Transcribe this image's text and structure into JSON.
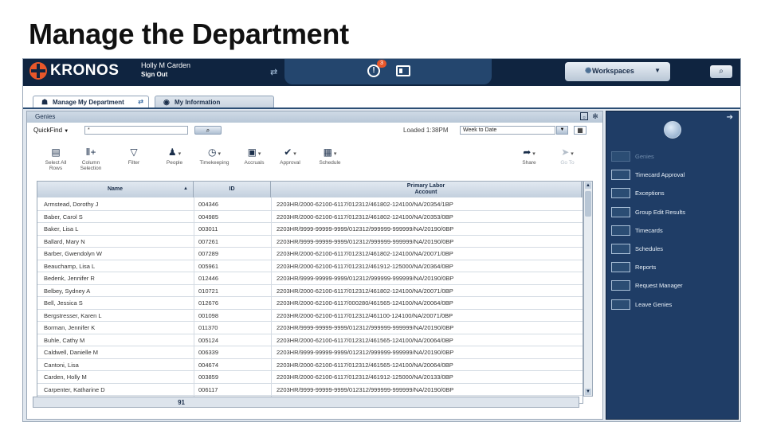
{
  "slide": {
    "title": "Manage the Department"
  },
  "topbar": {
    "logo_text": "KRONOS",
    "user_name": "Holly M Carden",
    "sign_out": "Sign Out",
    "alert_count": "3",
    "workspaces_label": "Workspaces"
  },
  "tabs": [
    {
      "label": "Manage My Department"
    },
    {
      "label": "My Information"
    }
  ],
  "genies": {
    "title": "Genies",
    "quickfind_label": "QuickFind",
    "quickfind_value": "*",
    "loaded": "Loaded 1:38PM",
    "period": "Week to Date",
    "toolbar": [
      {
        "icon": "select-all-icon",
        "label": "Select All\nRows",
        "glyph": "▤"
      },
      {
        "icon": "column-selection-icon",
        "label": "Column\nSelection",
        "glyph": "Ⅱ+"
      },
      {
        "icon": "filter-icon",
        "label": "Filter",
        "glyph": "▽"
      },
      {
        "icon": "people-icon",
        "label": "People",
        "glyph": "♟"
      },
      {
        "icon": "timekeeping-icon",
        "label": "Timekeeping",
        "glyph": "◷"
      },
      {
        "icon": "accruals-icon",
        "label": "Accruals",
        "glyph": "▣"
      },
      {
        "icon": "approval-icon",
        "label": "Approval",
        "glyph": "✔"
      },
      {
        "icon": "schedule-icon",
        "label": "Schedule",
        "glyph": "▦"
      },
      {
        "icon": "share-icon",
        "label": "Share",
        "glyph": "➦"
      },
      {
        "icon": "go-to-icon",
        "label": "Go To",
        "glyph": "➤"
      }
    ],
    "columns": {
      "name": "Name",
      "id": "ID",
      "account": "Primary Labor\nAccount"
    },
    "rows": [
      {
        "name": "Armstead, Dorothy J",
        "id": "004346",
        "account": "2203HR/2000-62100-6117/012312/461802-124100/NA/20354/1BP"
      },
      {
        "name": "Baber, Carol S",
        "id": "004985",
        "account": "2203HR/2000-62100-6117/012312/461802-124100/NA/20353/0BP"
      },
      {
        "name": "Baker, Lisa L",
        "id": "003011",
        "account": "2203HR/9999-99999-9999/012312/999999-999999/NA/20190/0BP"
      },
      {
        "name": "Ballard, Mary N",
        "id": "007261",
        "account": "2203HR/9999-99999-9999/012312/999999-999999/NA/20190/0BP"
      },
      {
        "name": "Barber, Gwendolyn W",
        "id": "007289",
        "account": "2203HR/2000-62100-6117/012312/461802-124100/NA/20071/0BP"
      },
      {
        "name": "Beauchamp, Lisa L",
        "id": "005961",
        "account": "2203HR/2000-62100-6117/012312/461912-125000/NA/20364/0BP"
      },
      {
        "name": "Bedenk, Jennifer R",
        "id": "012446",
        "account": "2203HR/9999-99999-9999/012312/999999-999999/NA/20190/0BP"
      },
      {
        "name": "Belbey, Sydney A",
        "id": "010721",
        "account": "2203HR/2000-62100-6117/012312/461802-124100/NA/20071/0BP"
      },
      {
        "name": "Bell, Jessica S",
        "id": "012676",
        "account": "2203HR/2000-62100-6117/000280/461565-124100/NA/20064/0BP"
      },
      {
        "name": "Bergstresser, Karen L",
        "id": "001098",
        "account": "2203HR/2000-62100-6117/012312/461100-124100/NA/20071/0BP"
      },
      {
        "name": "Borman, Jennifer K",
        "id": "011370",
        "account": "2203HR/9999-99999-9999/012312/999999-999999/NA/20190/0BP"
      },
      {
        "name": "Buhle, Cathy M",
        "id": "005124",
        "account": "2203HR/2000-62100-6117/012312/461565-124100/NA/20064/0BP"
      },
      {
        "name": "Caldwell, Danielle M",
        "id": "006339",
        "account": "2203HR/9999-99999-9999/012312/999999-999999/NA/20190/0BP"
      },
      {
        "name": "Cantoni, Lisa",
        "id": "004674",
        "account": "2203HR/2000-62100-6117/012312/461565-124100/NA/20064/0BP"
      },
      {
        "name": "Carden, Holly M",
        "id": "003859",
        "account": "2203HR/2000-62100-6117/012312/461912-125000/NA/20133/0BP"
      },
      {
        "name": "Carpenter, Katharine D",
        "id": "006117",
        "account": "2203HR/9999-99999-9999/012312/999999-999999/NA/20190/0BP"
      }
    ],
    "total_count": "91"
  },
  "right_panel": {
    "items": [
      {
        "label": "Genies",
        "disabled": true
      },
      {
        "label": "Timecard Approval",
        "disabled": false
      },
      {
        "label": "Exceptions",
        "disabled": false
      },
      {
        "label": "Group Edit Results",
        "disabled": false
      },
      {
        "label": "Timecards",
        "disabled": false
      },
      {
        "label": "Schedules",
        "disabled": false
      },
      {
        "label": "Reports",
        "disabled": false
      },
      {
        "label": "Request Manager",
        "disabled": false
      },
      {
        "label": "Leave Genies",
        "disabled": false
      }
    ]
  }
}
